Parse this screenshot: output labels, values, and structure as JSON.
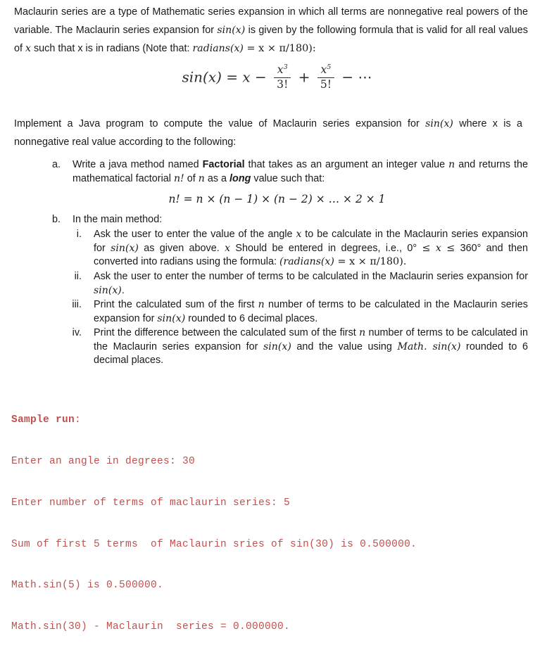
{
  "document": {
    "title": "Maclaurin series Java assignment",
    "text_color": "#1a1a1a",
    "sample_color": "#c0504d"
  },
  "intro": {
    "line1": "Maclaurin series are a type of Mathematic series expansion in which all terms are nonnegative real powers of the variable. The Maclaurin series expansion for ",
    "sin_x": "sin(x)",
    "line2": " is given by the following formula that is valid for all real values of ",
    "x_italic": "x",
    "line3": " such that x is in radians (Note that: ",
    "radians_formula": "radians(x)",
    "radians_rhs": " =  x × π/180):"
  },
  "formula_sin": {
    "lhs": "sin(x)",
    "eq": "=",
    "term1": "x",
    "minus": "−",
    "num1": "x",
    "exp1": "3",
    "den1": "3!",
    "plus": "+",
    "num2": "x",
    "exp2": "5",
    "den2": "5!",
    "minus2": "−",
    "ellipsis": "⋯"
  },
  "implement": {
    "part1": "Implement a Java program to compute the value of Maclaurin series expansion for ",
    "sin_x": "sin(x)",
    "part2": " where x is a nonnegative real value according to the following:"
  },
  "items": {
    "a": {
      "marker": "a.",
      "t1": "Write a java method named ",
      "bold1": "Factorial",
      "t2": " that takes as an argument an integer value ",
      "n1": "n",
      "t3": " and returns the mathematical factorial ",
      "n2": "n!",
      "t4": " of ",
      "n3": "n",
      "t5": " as a ",
      "bolditalic": "long",
      "t6": " value such that:"
    },
    "factorial_formula": {
      "text": "n! = n × (n − 1) × (n − 2) × … × 2  ×  1"
    },
    "b": {
      "marker": "b.",
      "text": "In the main method:"
    },
    "i": {
      "marker": "i.",
      "t1": "Ask the user to enter the value of the angle ",
      "x1": "x",
      "t2": " to be calculate in the Maclaurin series expansion for ",
      "sin1": "sin(x)",
      "t3": " as given above. ",
      "x2": "x",
      "t4": " Should be entered in degrees, i.e., 0° ",
      "le1": "≤",
      "x3": "x",
      "le2": "≤",
      "t5": " 360° and then converted into radians using the formula: ",
      "rad": "(radians(x)",
      "rad2": " =  x × π/180)."
    },
    "ii": {
      "marker": "ii.",
      "t1": "Ask the user to enter the number of terms to be calculated in the Maclaurin series expansion for ",
      "sin1": "sin(x)",
      "t2": "."
    },
    "iii": {
      "marker": "iii.",
      "t1": "Print the calculated sum of the first ",
      "n1": "n",
      "t2": " number of terms to be calculated in the Maclaurin series expansion for ",
      "sin1": "sin(x)",
      "t3": " rounded to 6 decimal places."
    },
    "iv": {
      "marker": "iv.",
      "t1": "Print the difference between the calculated sum of the first ",
      "n1": "n",
      "t2": " number of terms to be calculated in the Maclaurin series expansion for ",
      "sin1": "sin(x)",
      "t3": " and the value using ",
      "math1": "Math. sin(x)",
      "t4": " rounded to 6 decimal places."
    }
  },
  "sample_run": {
    "heading_bold": "Sample run",
    "heading_colon": ":",
    "lines": [
      "Enter an angle in degrees: 30",
      "Enter number of terms of maclaurin series: 5",
      "Sum of first 5 terms  of Maclaurin sries of sin(30) is 0.500000.",
      "Math.sin(5) is 0.500000.",
      "Math.sin(30) - Maclaurin  series = 0.000000."
    ]
  }
}
